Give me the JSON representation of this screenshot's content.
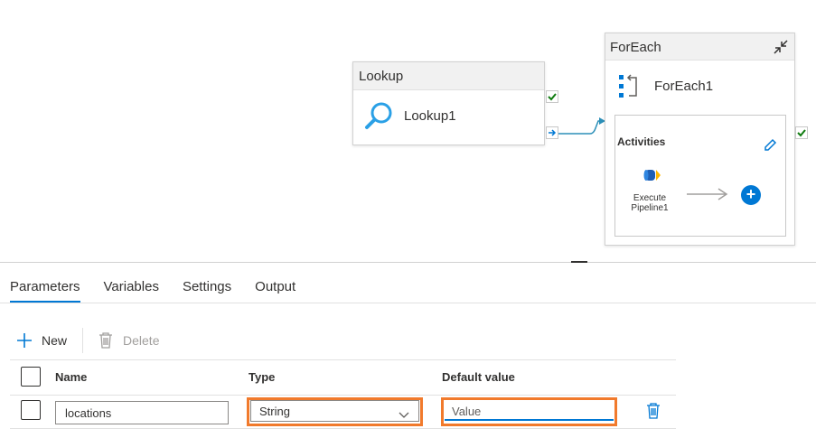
{
  "canvas": {
    "lookup": {
      "header": "Lookup",
      "name": "Lookup1"
    },
    "foreach": {
      "header": "ForEach",
      "name": "ForEach1",
      "activities_title": "Activities",
      "inner_activity": {
        "label_line1": "Execute",
        "label_line2": "Pipeline1"
      }
    }
  },
  "tabs": [
    {
      "label": "Parameters",
      "active": true
    },
    {
      "label": "Variables",
      "active": false
    },
    {
      "label": "Settings",
      "active": false
    },
    {
      "label": "Output",
      "active": false
    }
  ],
  "toolbar": {
    "new_label": "New",
    "delete_label": "Delete"
  },
  "table": {
    "headers": {
      "name": "Name",
      "type": "Type",
      "default": "Default value"
    },
    "rows": [
      {
        "name": "locations",
        "type": "String",
        "default_placeholder": "Value"
      }
    ]
  },
  "colors": {
    "accent": "#0078d4",
    "highlight": "#f17a2c",
    "success": "#107c10"
  },
  "icons": [
    "lookup-icon",
    "success-check-icon",
    "completion-arrow-icon",
    "foreach-icon",
    "collapse-icon",
    "edit-icon",
    "execute-pipeline-icon",
    "add-activity-icon",
    "plus-icon",
    "trash-icon",
    "chevron-down-icon"
  ]
}
